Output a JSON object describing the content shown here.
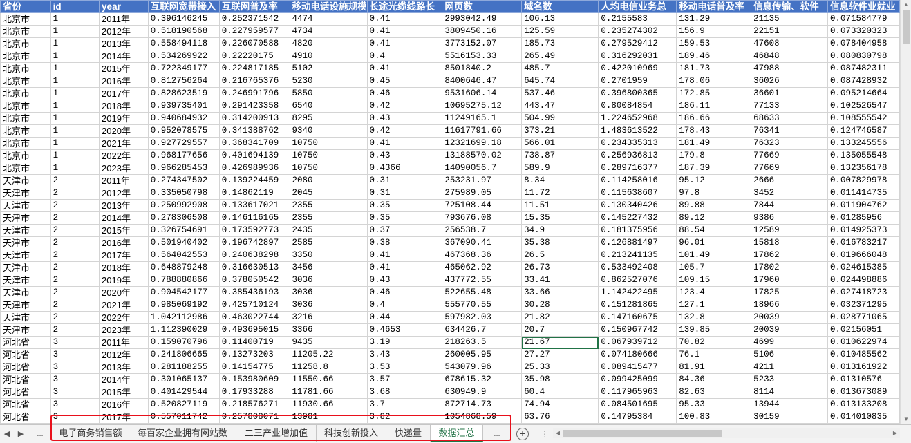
{
  "sheet": {
    "headers": [
      "省份",
      "id",
      "year",
      "互联网宽带接入",
      "互联网普及率",
      "移动电话设施规模",
      "长途光缆线路长",
      "网页数",
      "域名数",
      "人均电信业务总",
      "移动电话普及率",
      "信息传输、软件",
      "信息软件业就业"
    ],
    "rows": [
      [
        "北京市",
        "1",
        "2011年",
        "0.396146245",
        "0.252371542",
        "4474",
        "0.41",
        "2993042.49",
        "106.13",
        "0.2155583",
        "131.29",
        "21135",
        "0.071584779"
      ],
      [
        "北京市",
        "1",
        "2012年",
        "0.518190568",
        "0.227959577",
        "4734",
        "0.41",
        "3809450.16",
        "125.59",
        "0.235274302",
        "156.9",
        "22151",
        "0.073320323"
      ],
      [
        "北京市",
        "1",
        "2013年",
        "0.558494118",
        "0.226070588",
        "4820",
        "0.41",
        "3773152.07",
        "185.73",
        "0.279529412",
        "159.53",
        "47608",
        "0.078404958"
      ],
      [
        "北京市",
        "1",
        "2014年",
        "0.534269922",
        "0.22220175",
        "4910",
        "0.4",
        "5516153.33",
        "265.49",
        "0.316292031",
        "189.46",
        "46848",
        "0.080830798"
      ],
      [
        "北京市",
        "1",
        "2015年",
        "0.722349177",
        "0.224817185",
        "5102",
        "0.41",
        "8501840.2",
        "485.7",
        "0.422010969",
        "181.73",
        "47988",
        "0.087482311"
      ],
      [
        "北京市",
        "1",
        "2016年",
        "0.812756264",
        "0.216765376",
        "5230",
        "0.45",
        "8400646.47",
        "645.74",
        "0.2701959",
        "178.06",
        "36026",
        "0.087428932"
      ],
      [
        "北京市",
        "1",
        "2017年",
        "0.828623519",
        "0.246991796",
        "5850",
        "0.46",
        "9531606.14",
        "537.46",
        "0.396800365",
        "172.85",
        "36601",
        "0.095214664"
      ],
      [
        "北京市",
        "1",
        "2018年",
        "0.939735401",
        "0.291423358",
        "6540",
        "0.42",
        "10695275.12",
        "443.47",
        "0.80084854",
        "186.11",
        "77133",
        "0.102526547"
      ],
      [
        "北京市",
        "1",
        "2019年",
        "0.940684932",
        "0.314200913",
        "8295",
        "0.43",
        "11249165.1",
        "504.99",
        "1.224652968",
        "186.66",
        "68633",
        "0.108555542"
      ],
      [
        "北京市",
        "1",
        "2020年",
        "0.952078575",
        "0.341388762",
        "9340",
        "0.42",
        "11617791.66",
        "373.21",
        "1.483613522",
        "178.43",
        "76341",
        "0.124746587"
      ],
      [
        "北京市",
        "1",
        "2021年",
        "0.927729557",
        "0.368341709",
        "10750",
        "0.41",
        "12321699.18",
        "566.01",
        "0.234335313",
        "181.49",
        "76323",
        "0.133245556"
      ],
      [
        "北京市",
        "1",
        "2022年",
        "0.968177656",
        "0.401694139",
        "10750",
        "0.43",
        "13188570.02",
        "738.87",
        "0.256936813",
        "179.8",
        "77669",
        "0.135055548"
      ],
      [
        "北京市",
        "1",
        "2023年",
        "0.966285453",
        "0.426989936",
        "10750",
        "0.4366",
        "14090056.7",
        "589.9",
        "0.289716377",
        "187.39",
        "77669",
        "0.132356178"
      ],
      [
        "天津市",
        "2",
        "2011年",
        "0.274347502",
        "0.139224459",
        "2080",
        "0.31",
        "253231.97",
        "8.34",
        "0.114258016",
        "95.12",
        "2666",
        "0.007829978"
      ],
      [
        "天津市",
        "2",
        "2012年",
        "0.335050798",
        "0.14862119",
        "2045",
        "0.31",
        "275989.05",
        "11.72",
        "0.115638607",
        "97.8",
        "3452",
        "0.011414735"
      ],
      [
        "天津市",
        "2",
        "2013年",
        "0.250992908",
        "0.133617021",
        "2355",
        "0.35",
        "725108.44",
        "11.51",
        "0.130340426",
        "89.88",
        "7844",
        "0.011904762"
      ],
      [
        "天津市",
        "2",
        "2014年",
        "0.278306508",
        "0.146116165",
        "2355",
        "0.35",
        "793676.08",
        "15.35",
        "0.145227432",
        "89.12",
        "9386",
        "0.01285956"
      ],
      [
        "天津市",
        "2",
        "2015年",
        "0.326754691",
        "0.173592773",
        "2435",
        "0.37",
        "256538.7",
        "34.9",
        "0.181375956",
        "88.54",
        "12589",
        "0.014925373"
      ],
      [
        "天津市",
        "2",
        "2016年",
        "0.501940402",
        "0.196742897",
        "2585",
        "0.38",
        "367090.41",
        "35.38",
        "0.126881497",
        "96.01",
        "15818",
        "0.016783217"
      ],
      [
        "天津市",
        "2",
        "2017年",
        "0.564042553",
        "0.240638298",
        "3350",
        "0.41",
        "467368.36",
        "26.5",
        "0.213241135",
        "101.49",
        "17862",
        "0.019666048"
      ],
      [
        "天津市",
        "2",
        "2018年",
        "0.648879248",
        "0.316630513",
        "3456",
        "0.41",
        "465062.92",
        "26.73",
        "0.533492408",
        "105.7",
        "17802",
        "0.024615385"
      ],
      [
        "天津市",
        "2",
        "2019年",
        "0.788880866",
        "0.378050542",
        "3036",
        "0.43",
        "437772.55",
        "33.41",
        "0.862527076",
        "109.15",
        "17960",
        "0.024498886"
      ],
      [
        "天津市",
        "2",
        "2020年",
        "0.904542177",
        "0.385436193",
        "3036",
        "0.46",
        "522655.48",
        "33.66",
        "1.142422495",
        "123.4",
        "17825",
        "0.027418723"
      ],
      [
        "天津市",
        "2",
        "2021年",
        "0.985069192",
        "0.425710124",
        "3036",
        "0.4",
        "555770.55",
        "30.28",
        "0.151281865",
        "127.1",
        "18966",
        "0.032371295"
      ],
      [
        "天津市",
        "2",
        "2022年",
        "1.042112986",
        "0.463022744",
        "3216",
        "0.44",
        "597982.03",
        "21.82",
        "0.147160675",
        "132.8",
        "20039",
        "0.028771065"
      ],
      [
        "天津市",
        "2",
        "2023年",
        "1.112390029",
        "0.493695015",
        "3366",
        "0.4653",
        "634426.7",
        "20.7",
        "0.150967742",
        "139.85",
        "20039",
        "0.02156051"
      ],
      [
        "河北省",
        "3",
        "2011年",
        "0.159070796",
        "0.11400719",
        "9435",
        "3.19",
        "218263.5",
        "21.67",
        "0.067939712",
        "70.82",
        "4699",
        "0.010622974"
      ],
      [
        "河北省",
        "3",
        "2012年",
        "0.241806665",
        "0.13273203",
        "11205.22",
        "3.43",
        "260005.95",
        "27.27",
        "0.074180666",
        "76.1",
        "5106",
        "0.010485562"
      ],
      [
        "河北省",
        "3",
        "2013年",
        "0.281188255",
        "0.14154775",
        "11258.8",
        "3.53",
        "543079.96",
        "25.33",
        "0.089415477",
        "81.91",
        "4211",
        "0.013161922"
      ],
      [
        "河北省",
        "3",
        "2014年",
        "0.301065137",
        "0.153980609",
        "11550.66",
        "3.57",
        "678615.32",
        "35.98",
        "0.099425099",
        "84.36",
        "5233",
        "0.01310576"
      ],
      [
        "河北省",
        "3",
        "2015年",
        "0.401429544",
        "0.17933288",
        "11781.66",
        "3.68",
        "630949.9",
        "60.4",
        "0.117965963",
        "82.63",
        "8114",
        "0.013673089"
      ],
      [
        "河北省",
        "3",
        "2016年",
        "0.520827119",
        "0.218576271",
        "11930.66",
        "3.7",
        "872714.73",
        "74.94",
        "0.084501695",
        "95.33",
        "13944",
        "0.013133208"
      ],
      [
        "河北省",
        "3",
        "2017年",
        "0.557011742",
        "0.257808071",
        "13981",
        "3.82",
        "1054868.59",
        "63.76",
        "0.14795384",
        "100.83",
        "30159",
        "0.014010835"
      ]
    ]
  },
  "tabs": {
    "items": [
      "电子商务销售额",
      "每百家企业拥有网站数",
      "二三产业增加值",
      "科技创新投入",
      "快递量",
      "数据汇总"
    ],
    "more_left": "...",
    "more_right": "...",
    "add": "+",
    "separator": "⋮"
  },
  "colors": {
    "header_bg": "#4472c4",
    "active_tab": "#217346",
    "highlight_box": "#e8101b"
  }
}
